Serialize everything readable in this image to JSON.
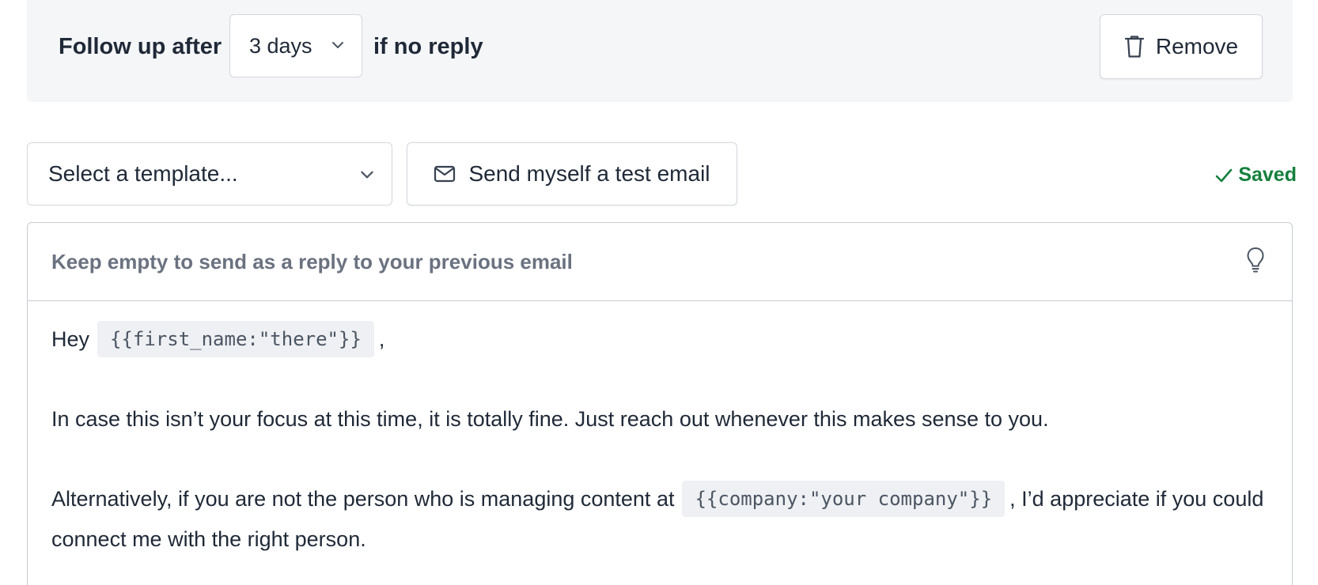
{
  "followup": {
    "prefix": "Follow up after",
    "delay_value": "3 days",
    "suffix": "if no reply",
    "remove_label": "Remove"
  },
  "toolbar": {
    "template_placeholder": "Select a template...",
    "test_email_label": "Send myself a test email",
    "status_label": "Saved"
  },
  "editor": {
    "subject_placeholder": "Keep empty to send as a reply to your previous email",
    "greeting_before": "Hey",
    "greeting_var": "{{first_name:\"there\"}}",
    "greeting_after": ",",
    "paragraph1": "In case this isn’t your focus at this time, it is totally fine. Just reach out whenever this makes sense to you.",
    "paragraph2_before": "Alternatively, if you are not the person who is managing content at",
    "paragraph2_var": "{{company:\"your company\"}}",
    "paragraph2_after": ", I’d appreciate if you could connect me with the right person."
  },
  "icons": {
    "delay_chevron": "chevron-down-icon",
    "remove": "trash-icon",
    "template_chevron": "chevron-down-icon",
    "test_email": "mail-icon",
    "status": "check-icon",
    "subject_hint": "lightbulb-icon"
  },
  "colors": {
    "saved": "#15803d",
    "panel_bg": "#f5f6f8",
    "border": "#d4d7dd",
    "variable_bg": "#eef0f3"
  }
}
